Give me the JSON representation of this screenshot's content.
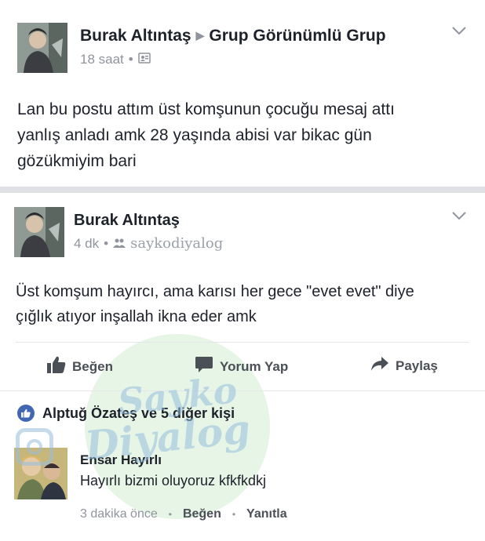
{
  "post1": {
    "author": "Burak Altıntaş",
    "group": "Grup Görünümlü Grup",
    "time": "18 saat",
    "text_lines": [
      "Lan bu postu attım üst komşunun çocuğu mesaj attı",
      "yanlış anladı amk 28 yaşında abisi var bikac gün",
      "gözükmiyim bari"
    ]
  },
  "post2": {
    "author": "Burak Altıntaş",
    "time": "4 dk",
    "watermark": "saykodiyalog",
    "text_lines": [
      "Üst komşum hayırcı, ama karısı her gece  \"evet evet\" diye",
      "çığlık atıyor inşallah ikna eder amk"
    ],
    "actions": {
      "like": "Beğen",
      "comment": "Yorum Yap",
      "share": "Paylaş"
    },
    "reactions_text": "Alptuğ Özateş ve 5 diğer kişi",
    "comment": {
      "author": "Ensar Hayırlı",
      "text": "Hayırlı bizmi oluyoruz kfkfkdkj",
      "time": "3 dakika önce",
      "like": "Beğen",
      "reply": "Yanıtla"
    }
  },
  "overlay": {
    "line1": "Sayko",
    "line2": "Diyalog"
  },
  "colors": {
    "facebook_blue": "#4267b2",
    "text_dark": "#1d2129",
    "text_grey": "#90949c",
    "action_grey": "#4b4f56"
  }
}
